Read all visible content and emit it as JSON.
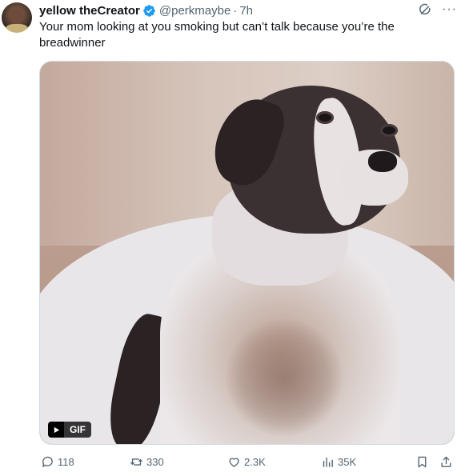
{
  "tweet": {
    "author_name": "yellow theCreator",
    "handle": "@perkmaybe",
    "separator": "·",
    "timestamp": "7h",
    "text": "Your mom looking at you smoking but can’t talk because you’re the breadwinner",
    "more_label": "···"
  },
  "media": {
    "badge_label": "GIF",
    "subject": "dog-gif"
  },
  "actions": {
    "replies": "118",
    "reposts": "330",
    "likes": "2.3K",
    "views": "35K"
  },
  "icons": {
    "verified": "verified-badge-icon",
    "grok": "grok-icon",
    "more": "more-icon",
    "reply": "reply-icon",
    "repost": "repost-icon",
    "like": "heart-icon",
    "views": "views-icon",
    "bookmark": "bookmark-icon",
    "share": "share-icon"
  },
  "colors": {
    "verified_blue": "#1d9bf0",
    "text_primary": "#0f1419",
    "text_secondary": "#536471"
  }
}
